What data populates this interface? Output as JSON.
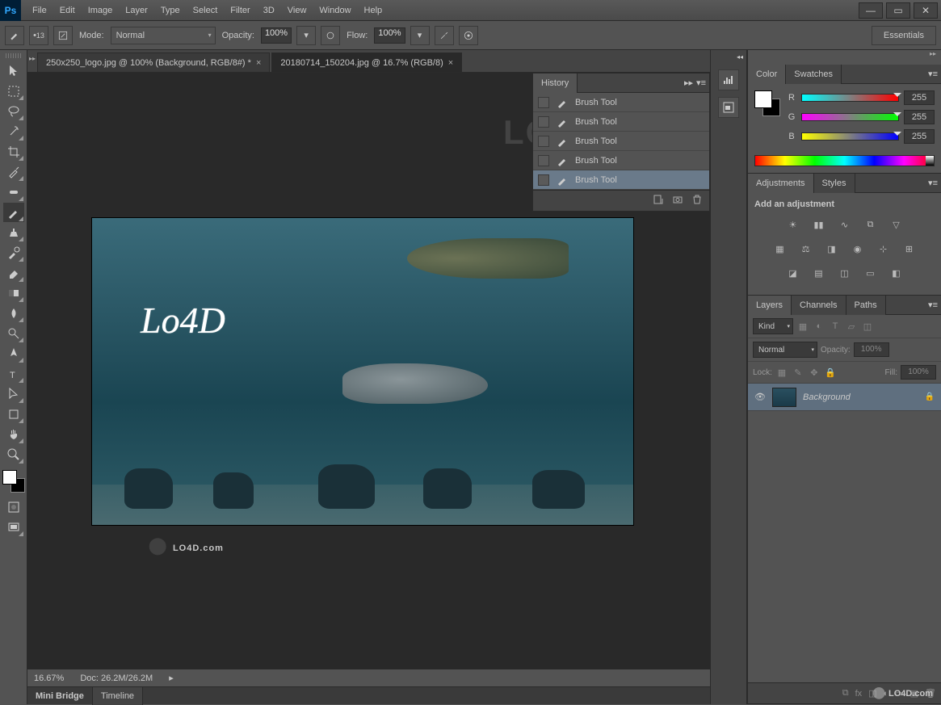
{
  "menu": [
    "File",
    "Edit",
    "Image",
    "Layer",
    "Type",
    "Select",
    "Filter",
    "3D",
    "View",
    "Window",
    "Help"
  ],
  "options": {
    "brush_size": "13",
    "mode_label": "Mode:",
    "mode_value": "Normal",
    "opacity_label": "Opacity:",
    "opacity_value": "100%",
    "flow_label": "Flow:",
    "flow_value": "100%",
    "workspace": "Essentials"
  },
  "tabs": [
    {
      "title": "250x250_logo.jpg @ 100% (Background, RGB/8#) *",
      "active": false
    },
    {
      "title": "20180714_150204.jpg @ 16.7% (RGB/8)",
      "active": true
    }
  ],
  "canvas_text": "Lo4D",
  "watermark": "LO4D.com",
  "history": {
    "tab": "History",
    "items": [
      "Brush Tool",
      "Brush Tool",
      "Brush Tool",
      "Brush Tool",
      "Brush Tool"
    ],
    "selected": 4
  },
  "status": {
    "zoom": "16.67%",
    "doc": "Doc: 26.2M/26.2M"
  },
  "bottom_tabs": [
    "Mini Bridge",
    "Timeline"
  ],
  "color_panel": {
    "tabs": [
      "Color",
      "Swatches"
    ],
    "r": "255",
    "g": "255",
    "b": "255"
  },
  "adjustments": {
    "tabs": [
      "Adjustments",
      "Styles"
    ],
    "title": "Add an adjustment"
  },
  "layers": {
    "tabs": [
      "Layers",
      "Channels",
      "Paths"
    ],
    "kind": "Kind",
    "blend": "Normal",
    "opacity_label": "Opacity:",
    "opacity_value": "100%",
    "lock_label": "Lock:",
    "fill_label": "Fill:",
    "fill_value": "100%",
    "layer_name": "Background"
  }
}
